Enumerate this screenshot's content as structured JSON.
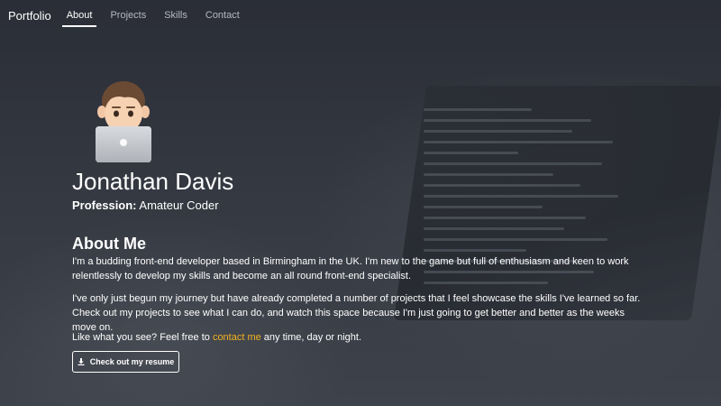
{
  "nav": {
    "brand": "Portfolio",
    "links": [
      "About",
      "Projects",
      "Skills",
      "Contact"
    ],
    "active": "About"
  },
  "profile": {
    "name": "Jonathan Davis",
    "profession_label": "Profession:",
    "profession_value": "Amateur Coder",
    "avatar_icon": "man-technologist-icon"
  },
  "about": {
    "title": "About Me",
    "paragraph1": "I'm a budding front-end developer based in Birmingham in the UK. I'm new to the game but full of enthusiasm and keen to work relentlessly to develop my skills and become an all round front-end specialist.",
    "paragraph2": "I've only just begun my journey but have already completed a number of projects that I feel showcase the skills I've learned so far. Check out my projects to see what I can do, and watch this space because I'm just going to get better and better as the weeks move on.",
    "paragraph3_before": "Like what you see? Feel free to ",
    "paragraph3_link": "contact me",
    "paragraph3_after": " any time, day or night.",
    "resume_button": "Check out my resume",
    "resume_icon": "download-icon"
  },
  "colors": {
    "link_accent": "#f2b01e",
    "text": "#ffffff"
  }
}
